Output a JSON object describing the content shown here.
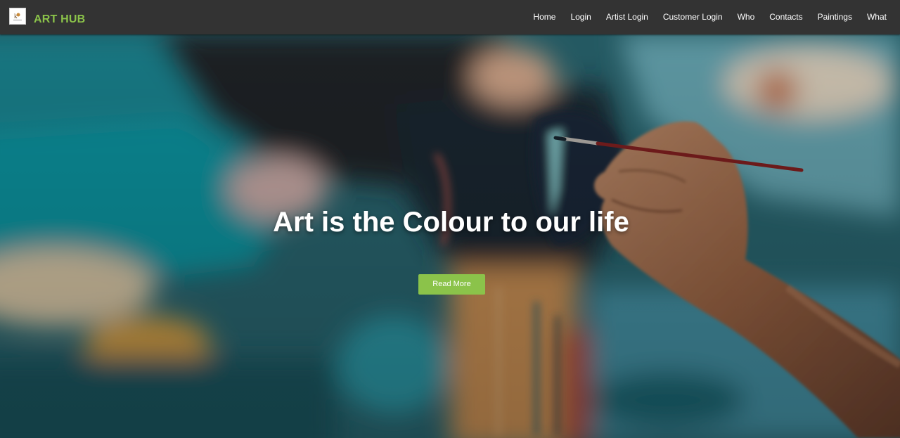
{
  "navbar": {
    "brand": "ART HUB",
    "logo_icon": "art-hub-logo-icon",
    "links": [
      {
        "label": "Home"
      },
      {
        "label": "Login"
      },
      {
        "label": "Artist Login"
      },
      {
        "label": "Customer Login"
      },
      {
        "label": "Who"
      },
      {
        "label": "Contacts"
      },
      {
        "label": "Paintings"
      },
      {
        "label": "What"
      }
    ]
  },
  "hero": {
    "title": "Art is the Colour to our life",
    "button_label": "Read More"
  },
  "colors": {
    "accent": "#8bc34a",
    "navbar_bg": "#333333",
    "text_light": "#ffffff"
  }
}
